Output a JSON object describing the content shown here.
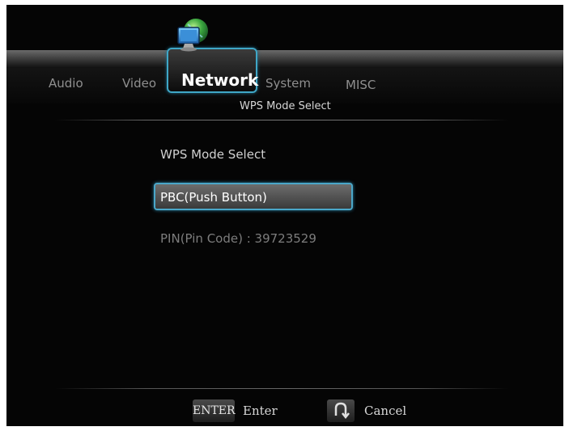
{
  "tabs": {
    "audio": "Audio",
    "video": "Video",
    "network": "Network",
    "system": "System",
    "misc": "MISC"
  },
  "header": {
    "subtitle": "WPS Mode Select"
  },
  "main": {
    "section_title": "WPS Mode Select",
    "options": [
      "PBC(Push Button)",
      "PIN(Pin Code) : 39723529"
    ],
    "selected_index": 0
  },
  "footer": {
    "enter_key": "ENTER",
    "enter_label": "Enter",
    "cancel_label": "Cancel",
    "cancel_icon": "return-arrow-icon"
  },
  "colors": {
    "accent": "#3fa7c7",
    "background": "#050505"
  }
}
